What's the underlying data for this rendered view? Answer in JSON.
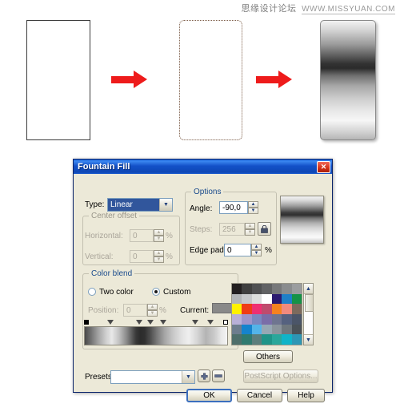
{
  "watermark": {
    "cn_text": "思缘设计论坛",
    "url_text": "WWW.MISSYUAN.COM"
  },
  "illustration": {
    "step1_name": "plain-rectangle",
    "step2_name": "rounded-rectangle-selected",
    "step3_name": "metallic-gradient-rectangle",
    "arrow_glyph": "→"
  },
  "dialog": {
    "title": "Fountain Fill",
    "close_label": "✕",
    "type": {
      "label": "Type:",
      "value": "Linear",
      "arrow": "▼"
    },
    "center_offset": {
      "legend": "Center offset",
      "horizontal_label": "Horizontal:",
      "horizontal_value": "0",
      "horizontal_unit": "%",
      "vertical_label": "Vertical:",
      "vertical_value": "0",
      "vertical_unit": "%"
    },
    "options": {
      "legend": "Options",
      "angle_label": "Angle:",
      "angle_value": "-90,0",
      "steps_label": "Steps:",
      "steps_value": "256",
      "lock_icon": "lock-icon",
      "edge_pad_label": "Edge pad:",
      "edge_pad_value": "0",
      "edge_pad_unit": "%"
    },
    "color_blend": {
      "legend": "Color blend",
      "two_color_label": "Two color",
      "two_color_selected": false,
      "custom_label": "Custom",
      "custom_selected": true,
      "position_label": "Position:",
      "position_value": "0",
      "position_unit": "%",
      "current_label": "Current:",
      "current_swatch_color": "#898989",
      "markers": [
        {
          "type": "square-black",
          "pos": 0
        },
        {
          "type": "triangle",
          "pos": 17
        },
        {
          "type": "triangle",
          "pos": 38
        },
        {
          "type": "triangle",
          "pos": 46
        },
        {
          "type": "triangle",
          "pos": 55
        },
        {
          "type": "triangle",
          "pos": 78
        },
        {
          "type": "triangle",
          "pos": 89
        },
        {
          "type": "square-white",
          "pos": 100
        }
      ],
      "others_button": "Others",
      "palette_colors": [
        "#231f20",
        "#3f3f3f",
        "#4f5052",
        "#616264",
        "#77787a",
        "#8a8c8e",
        "#9b9d9f",
        "#b2b4b6",
        "#c6c8ca",
        "#dcdedd",
        "#ffffff",
        "#2b1a70",
        "#1f7fc7",
        "#159247",
        "#fff200",
        "#ef3c16",
        "#ee3072",
        "#bf4b6d",
        "#f58220",
        "#f08a7e",
        "#7c6a5d",
        "#b9b0d8",
        "#9e93c9",
        "#7b87bf",
        "#7a6ea8",
        "#6f7590",
        "#55617f",
        "#4b5568",
        "#6e7d8e",
        "#1583cd",
        "#54b4e8",
        "#96a8b4",
        "#8b949c",
        "#6f777d",
        "#4b5258",
        "#4f6f6b",
        "#2f7a70",
        "#5c7e7c",
        "#1f9488",
        "#2aa79b",
        "#10b4c8",
        "#2d96b5"
      ],
      "scroll_up": "▲",
      "scroll_down": "▼"
    },
    "presets": {
      "label": "Presets:",
      "value": "",
      "arrow": "▼",
      "add_label": "＋",
      "remove_label": "－"
    },
    "postscript_button": "PostScript Options...",
    "ok_button": "OK",
    "cancel_button": "Cancel",
    "help_button": "Help"
  }
}
